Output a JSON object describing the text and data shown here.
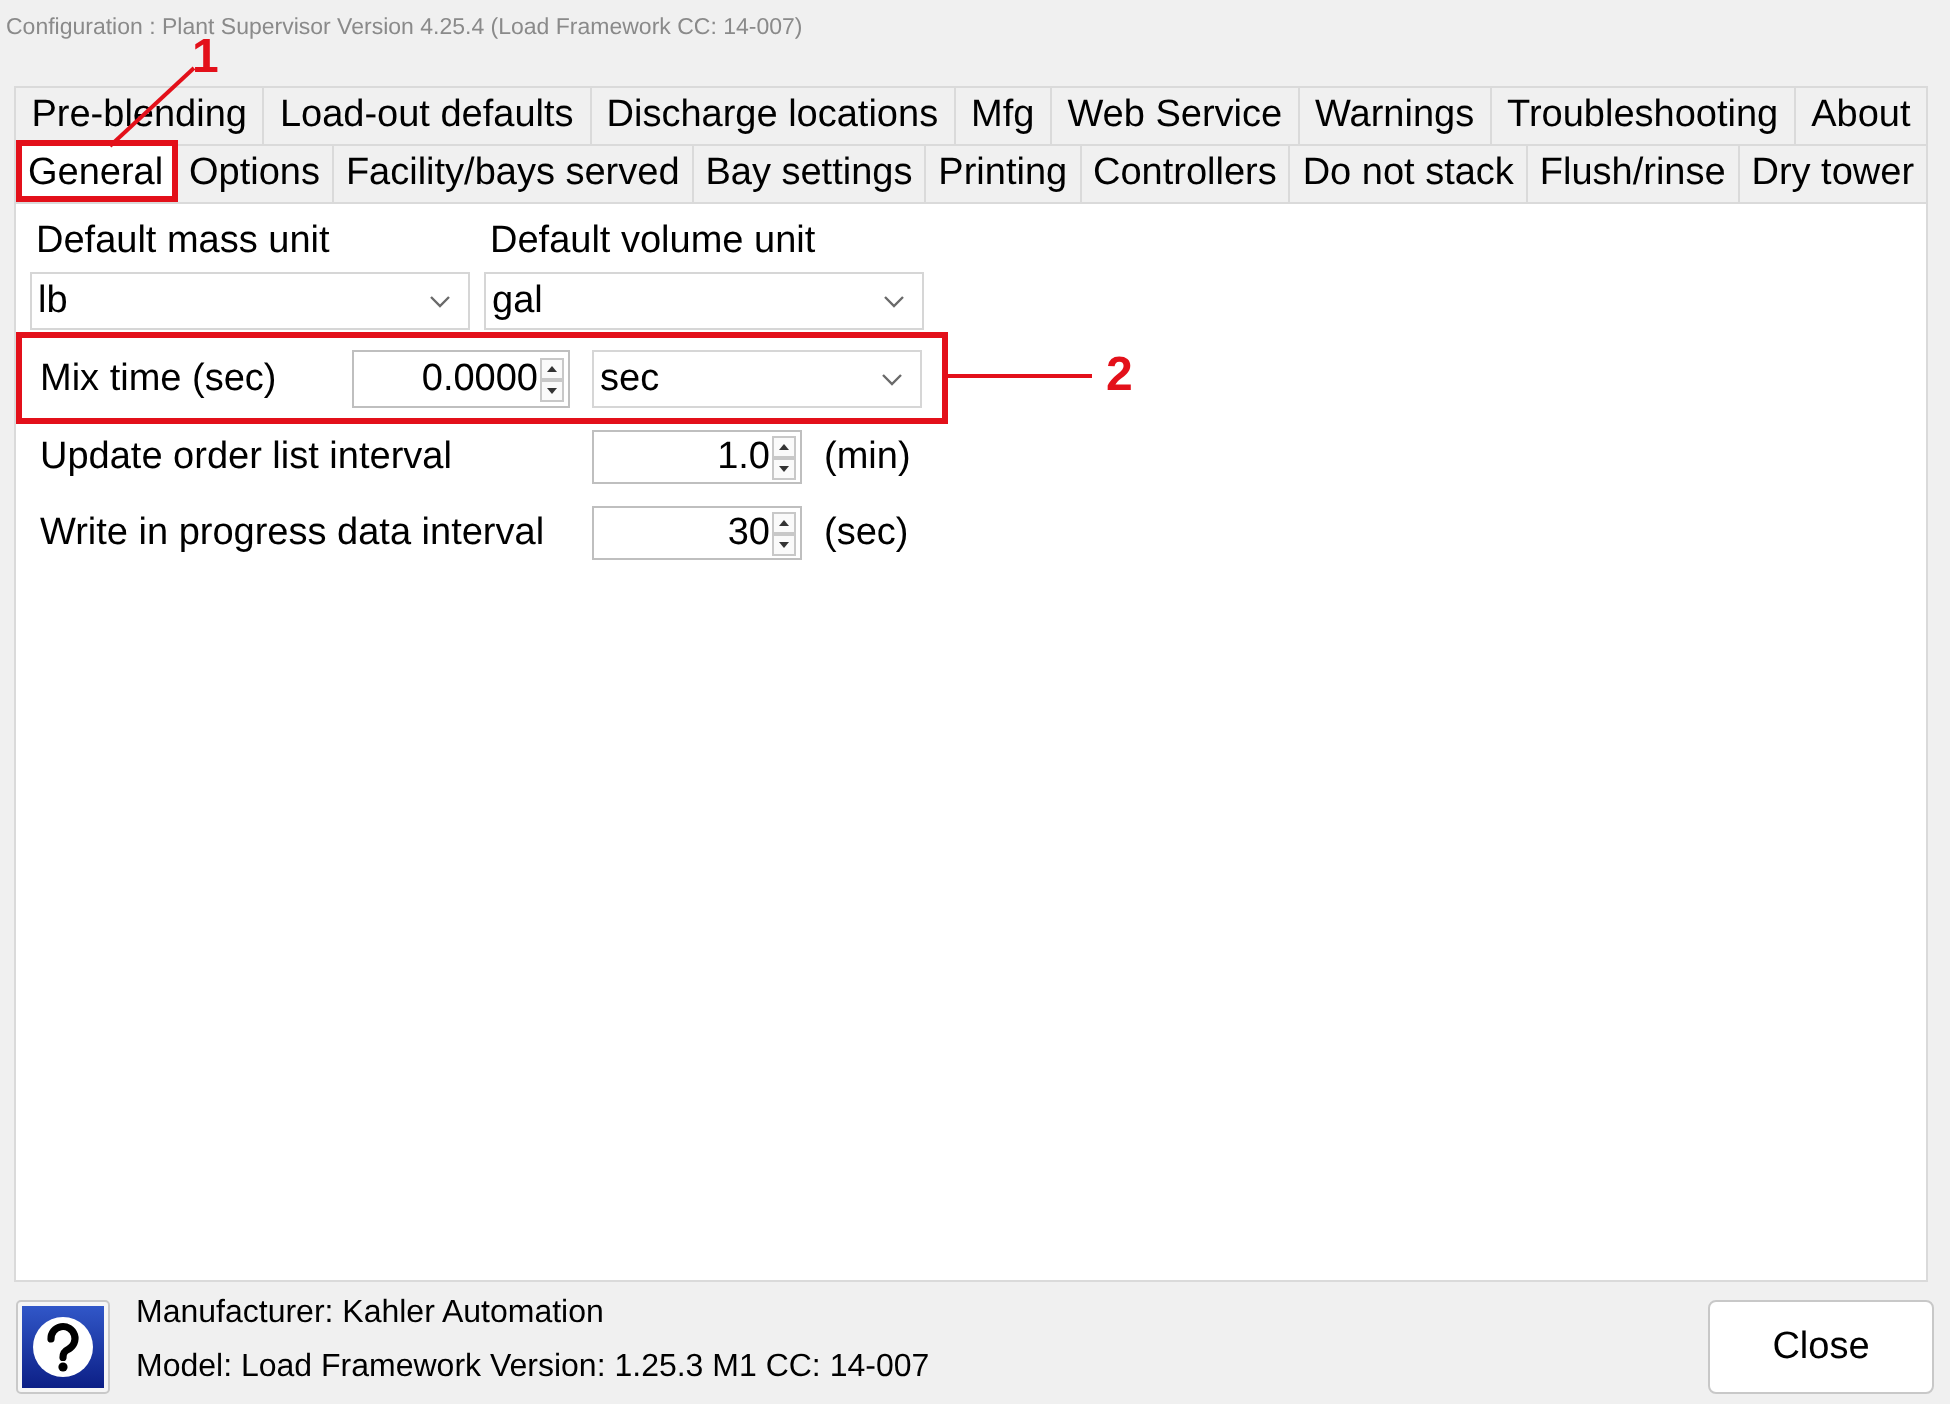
{
  "window": {
    "title": "Configuration : Plant Supervisor Version 4.25.4 (Load Framework CC: 14-007)"
  },
  "tab_rows": [
    {
      "tabs": [
        {
          "label": "Pre-blending",
          "selected": false
        },
        {
          "label": "Load-out defaults",
          "selected": false
        },
        {
          "label": "Discharge locations",
          "selected": false
        },
        {
          "label": "Mfg",
          "selected": false
        },
        {
          "label": "Web Service",
          "selected": false
        },
        {
          "label": "Warnings",
          "selected": false
        },
        {
          "label": "Troubleshooting",
          "selected": false
        },
        {
          "label": "About",
          "selected": false
        }
      ]
    },
    {
      "tabs": [
        {
          "label": "General",
          "selected": true,
          "callout": "1"
        },
        {
          "label": "Options",
          "selected": false
        },
        {
          "label": "Facility/bays served",
          "selected": false
        },
        {
          "label": "Bay settings",
          "selected": false
        },
        {
          "label": "Printing",
          "selected": false
        },
        {
          "label": "Controllers",
          "selected": false
        },
        {
          "label": "Do not stack",
          "selected": false
        },
        {
          "label": "Flush/rinse",
          "selected": false
        },
        {
          "label": "Dry tower",
          "selected": false
        }
      ]
    }
  ],
  "unit_selects": [
    {
      "label": "Default mass unit",
      "value": "lb"
    },
    {
      "label": "Default volume unit",
      "value": "gal"
    }
  ],
  "settings": [
    {
      "label": "Mix time (sec)",
      "value": "0.0000",
      "unit": {
        "kind": "select",
        "value": "sec"
      },
      "callout": "2"
    },
    {
      "label": "Update order list interval",
      "value": "1.0",
      "unit": {
        "kind": "text",
        "value": "(min)"
      }
    },
    {
      "label": "Write in progress data interval",
      "value": "30",
      "unit": {
        "kind": "text",
        "value": "(sec)"
      }
    }
  ],
  "footer": {
    "manufacturer": "Manufacturer: Kahler Automation",
    "model": "Model: Load Framework Version: 1.25.3 M1 CC: 14-007",
    "button": "Close"
  }
}
